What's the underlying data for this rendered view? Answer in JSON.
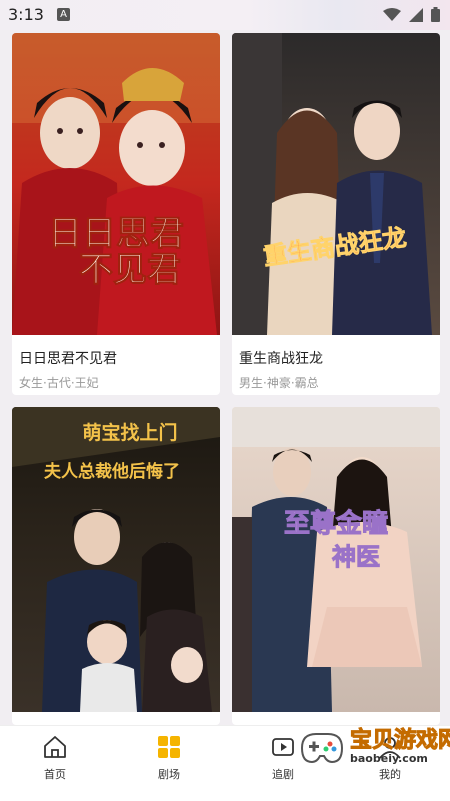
{
  "status_bar": {
    "time": "3:13",
    "notification_letter": "A"
  },
  "cards": [
    {
      "title": "日日思君不见君",
      "tags": "女生·古代·王妃",
      "poster_text": [
        "日日思君",
        "不见君"
      ]
    },
    {
      "title": "重生商战狂龙",
      "tags": "男生·神豪·霸总",
      "poster_text": [
        "重生商战狂龙"
      ]
    },
    {
      "title": "",
      "tags": "",
      "poster_text": [
        "萌宝找上门",
        "夫人总裁他后悔了"
      ]
    },
    {
      "title": "",
      "tags": "",
      "poster_text": [
        "至尊金瞳",
        "神医"
      ]
    }
  ],
  "nav": {
    "items": [
      {
        "label": "首页",
        "icon": "home-icon",
        "active": false
      },
      {
        "label": "剧场",
        "icon": "theater-icon",
        "active": true
      },
      {
        "label": "追剧",
        "icon": "follow-icon",
        "active": false
      },
      {
        "label": "我的",
        "icon": "profile-icon",
        "active": false
      }
    ]
  },
  "watermark": {
    "title": "宝贝游戏网",
    "url": "baobeiy.com"
  },
  "colors": {
    "accent": "#f5b400",
    "poster1_bg": "#c21f1f",
    "poster2_bg": "#3b3030"
  }
}
